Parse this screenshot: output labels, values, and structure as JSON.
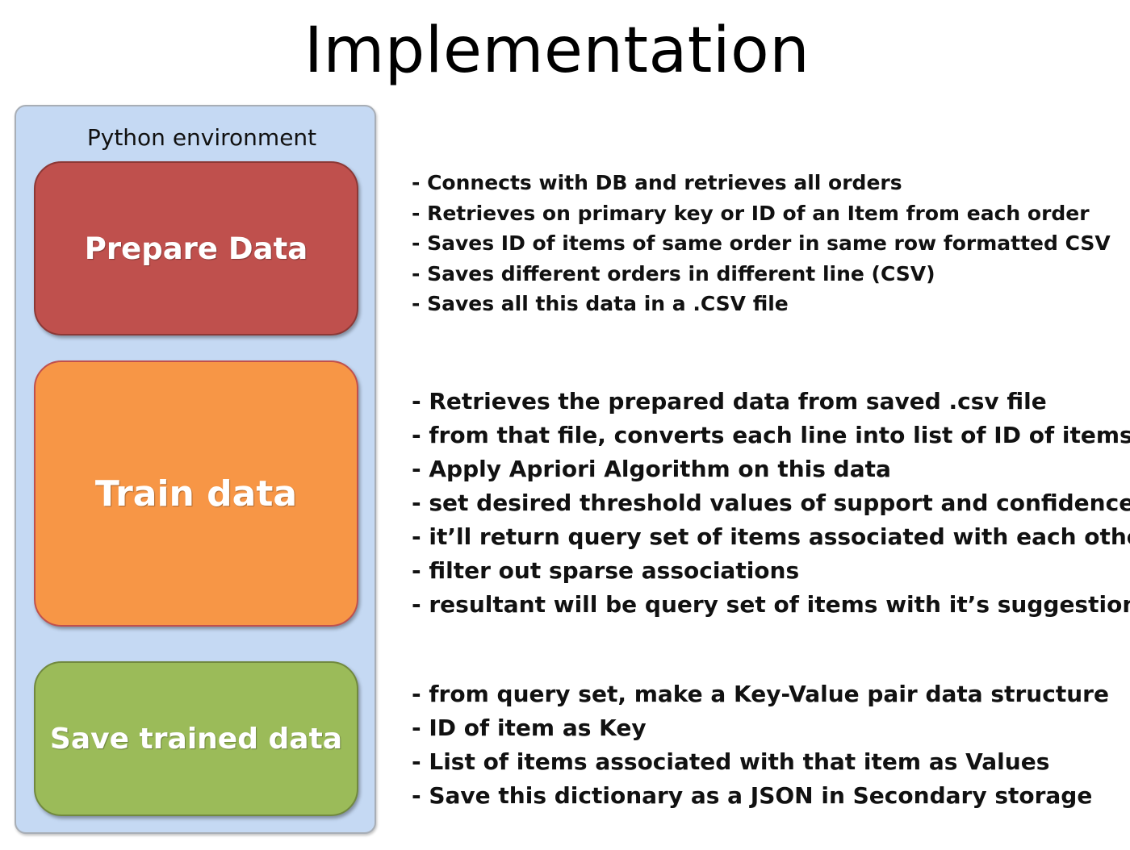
{
  "title": "Implementation",
  "environment": {
    "label": "Python environment"
  },
  "stages": {
    "prepare": {
      "label": "Prepare Data",
      "color": "#bf504d",
      "notes": [
        "- Connects with DB and retrieves all orders",
        "- Retrieves on primary key or ID of an Item from each order",
        "- Saves ID of items of same order in same row formatted CSV",
        "- Saves different orders in different line (CSV)",
        "- Saves all this data in a .CSV file"
      ]
    },
    "train": {
      "label": "Train data",
      "color": "#f79646",
      "notes": [
        "- Retrieves the prepared data from saved .csv file",
        "- from that file, converts each line into list of ID of items",
        "- Apply Apriori Algorithm on this data",
        "- set desired threshold values of support and confidence",
        "- it’ll return query set of items associated with each other",
        "- filter out sparse associations",
        "- resultant will be query set of items with it’s suggestions"
      ]
    },
    "save": {
      "label": "Save trained data",
      "color": "#9bbb59",
      "notes": [
        "- from query set, make a Key-Value pair data structure",
        "- ID of item as Key",
        "- List of items associated with that item as Values",
        "- Save this dictionary as a JSON in Secondary storage"
      ]
    }
  },
  "colors": {
    "environment_fill": "#c5d9f3",
    "environment_border": "#a8aeb6"
  }
}
